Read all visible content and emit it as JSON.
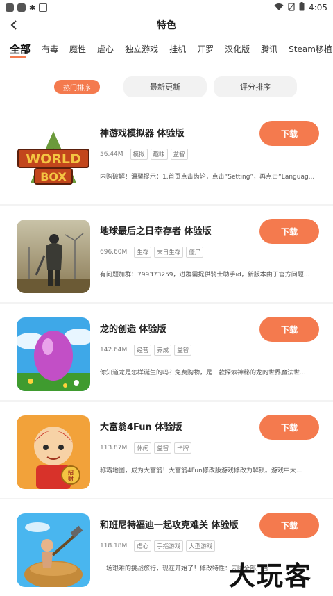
{
  "status": {
    "time": "4:05"
  },
  "nav": {
    "title": "特色"
  },
  "tabs": [
    "全部",
    "有毒",
    "魔性",
    "虐心",
    "独立游戏",
    "挂机",
    "开罗",
    "汉化版",
    "腾讯",
    "Steam移植"
  ],
  "sorts": [
    "热门排序",
    "最新更新",
    "评分排序"
  ],
  "games": [
    {
      "title": "神游戏模拟器 体验版",
      "size": "56.44M",
      "tags": [
        "模拟",
        "趣味",
        "益智"
      ],
      "desc": "内购破解！温馨提示：1.首页点击齿轮，点击“Setting”，再点击“Languag...",
      "button": "下载",
      "thumb_text": [
        "WORLD",
        "BOX"
      ]
    },
    {
      "title": "地球最后之日幸存者 体验版",
      "size": "696.60M",
      "tags": [
        "生存",
        "末日生存",
        "僵尸"
      ],
      "desc": "有问题加群：799373259，进群需提供骑士助手id，新版本由于官方问题...",
      "button": "下载"
    },
    {
      "title": "龙的创造 体验版",
      "size": "142.64M",
      "tags": [
        "经营",
        "养成",
        "益智"
      ],
      "desc": "你知道龙是怎样诞生的吗？免费购物，是一款探索神秘的龙的世界魔法世...",
      "button": "下载"
    },
    {
      "title": "大富翁4Fun 体验版",
      "size": "113.87M",
      "tags": [
        "休闲",
        "益智",
        "卡牌"
      ],
      "desc": "称霸地图，成为大富翁！大富翁4Fun修改版游戏修改为解锁。游戏中大...",
      "button": "下载",
      "thumb_text": [
        "招",
        "财"
      ]
    },
    {
      "title": "和班尼特福迪一起攻克难关 体验版",
      "size": "118.18M",
      "tags": [
        "虐心",
        "手指游戏",
        "大型游戏"
      ],
      "desc": "一场艰难的挑战旅行，现在开始了！修改特性：去除全部广告",
      "button": "下载"
    }
  ],
  "watermark": "大玩客",
  "colors": {
    "accent": "#f47a4e"
  }
}
